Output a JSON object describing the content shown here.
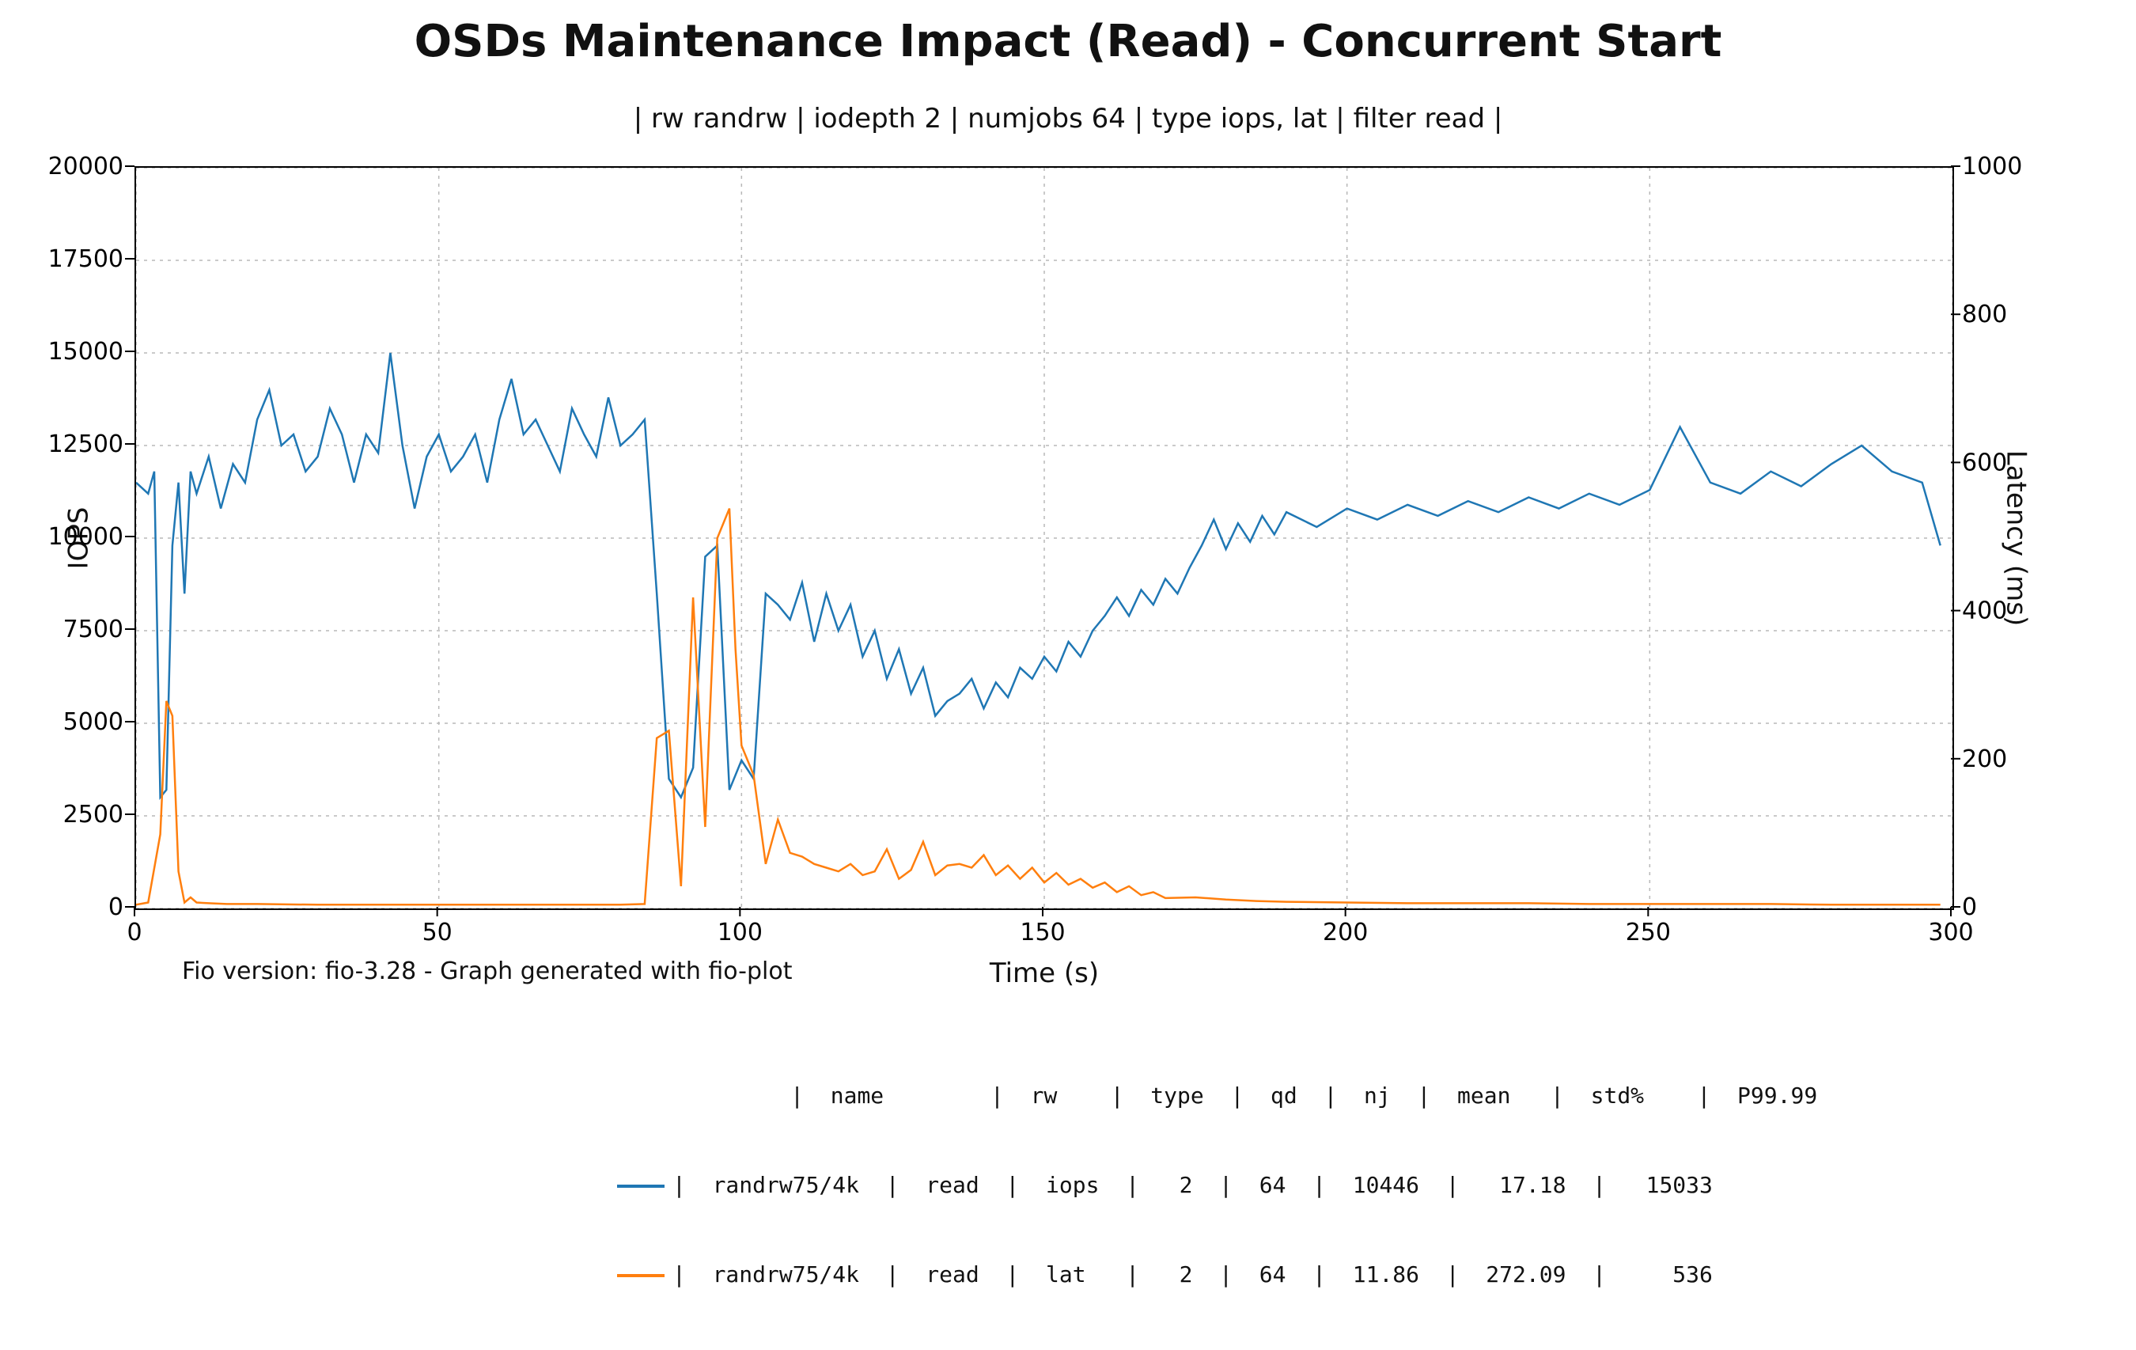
{
  "chart_data": {
    "type": "line",
    "title": "OSDs Maintenance Impact (Read) - Concurrent Start",
    "subtitle": "| rw randrw | iodepth 2 | numjobs 64 | type iops, lat | filter read |",
    "xlabel": "Time (s)",
    "ylabel": "IOPS",
    "y2label": "Latency (ms)",
    "xlim": [
      0,
      300
    ],
    "ylim": [
      0,
      20000
    ],
    "y2lim": [
      0,
      1000
    ],
    "xticks": [
      0,
      50,
      100,
      150,
      200,
      250,
      300
    ],
    "yticks": [
      0,
      2500,
      5000,
      7500,
      10000,
      12500,
      15000,
      17500,
      20000
    ],
    "y2ticks": [
      0,
      200,
      400,
      600,
      800,
      1000
    ],
    "footer_note": "Fio version: fio-3.28 - Graph generated with fio-plot",
    "legend_header": "|  name        |  rw    |  type  |  qd  |  nj  |  mean   |  std%    |  P99.99",
    "series": [
      {
        "name": "iops",
        "axis": "left",
        "color": "#1f77b4",
        "legend_row": "|  randrw75/4k  |  read  |  iops  |   2  |  64  |  10446  |   17.18  |   15033",
        "x": [
          0,
          2,
          3,
          4,
          5,
          6,
          7,
          8,
          9,
          10,
          12,
          14,
          16,
          18,
          20,
          22,
          24,
          26,
          28,
          30,
          32,
          34,
          36,
          38,
          40,
          42,
          44,
          46,
          48,
          50,
          52,
          54,
          56,
          58,
          60,
          62,
          64,
          66,
          68,
          70,
          72,
          74,
          76,
          78,
          80,
          82,
          84,
          86,
          88,
          90,
          92,
          94,
          96,
          98,
          100,
          102,
          104,
          106,
          108,
          110,
          112,
          114,
          116,
          118,
          120,
          122,
          124,
          126,
          128,
          130,
          132,
          134,
          136,
          138,
          140,
          142,
          144,
          146,
          148,
          150,
          152,
          154,
          156,
          158,
          160,
          162,
          164,
          166,
          168,
          170,
          172,
          174,
          176,
          178,
          180,
          182,
          184,
          186,
          188,
          190,
          195,
          200,
          205,
          210,
          215,
          220,
          225,
          230,
          235,
          240,
          245,
          250,
          255,
          260,
          265,
          270,
          275,
          280,
          285,
          290,
          295,
          298
        ],
        "values": [
          11500,
          11200,
          11800,
          3000,
          3200,
          9800,
          11500,
          8500,
          11800,
          11200,
          12200,
          10800,
          12000,
          11500,
          13200,
          14000,
          12500,
          12800,
          11800,
          12200,
          13500,
          12800,
          11500,
          12800,
          12300,
          15000,
          12500,
          10800,
          12200,
          12800,
          11800,
          12200,
          12800,
          11500,
          13200,
          14300,
          12800,
          13200,
          12500,
          11800,
          13500,
          12800,
          12200,
          13800,
          12500,
          12800,
          13200,
          8500,
          3500,
          3000,
          3800,
          9500,
          9800,
          3200,
          4000,
          3500,
          8500,
          8200,
          7800,
          8800,
          7200,
          8500,
          7500,
          8200,
          6800,
          7500,
          6200,
          7000,
          5800,
          6500,
          5200,
          5600,
          5800,
          6200,
          5400,
          6100,
          5700,
          6500,
          6200,
          6800,
          6400,
          7200,
          6800,
          7500,
          7900,
          8400,
          7900,
          8600,
          8200,
          8900,
          8500,
          9200,
          9800,
          10500,
          9700,
          10400,
          9900,
          10600,
          10100,
          10700,
          10300,
          10800,
          10500,
          10900,
          10600,
          11000,
          10700,
          11100,
          10800,
          11200,
          10900,
          11300,
          13000,
          11500,
          11200,
          11800,
          11400,
          12000,
          12500,
          11800,
          11500,
          9800
        ]
      },
      {
        "name": "lat",
        "axis": "right",
        "color": "#ff7f0e",
        "legend_row": "|  randrw75/4k  |  read  |  lat   |   2  |  64  |  11.86  |  272.09  |     536",
        "x": [
          0,
          2,
          4,
          5,
          6,
          7,
          8,
          9,
          10,
          12,
          15,
          20,
          30,
          40,
          50,
          60,
          70,
          80,
          84,
          86,
          88,
          90,
          92,
          94,
          96,
          98,
          99,
          100,
          102,
          104,
          106,
          108,
          110,
          112,
          114,
          116,
          118,
          120,
          122,
          124,
          126,
          128,
          130,
          132,
          134,
          136,
          138,
          140,
          142,
          144,
          146,
          148,
          150,
          152,
          154,
          156,
          158,
          160,
          162,
          164,
          166,
          168,
          170,
          175,
          180,
          185,
          190,
          200,
          210,
          220,
          230,
          240,
          250,
          260,
          270,
          280,
          290,
          298
        ],
        "values": [
          5,
          8,
          100,
          280,
          260,
          50,
          8,
          15,
          8,
          7,
          6,
          6,
          5,
          5,
          5,
          5,
          5,
          5,
          6,
          230,
          240,
          30,
          420,
          110,
          500,
          540,
          350,
          220,
          180,
          60,
          120,
          75,
          70,
          60,
          55,
          50,
          60,
          45,
          50,
          80,
          40,
          52,
          90,
          45,
          58,
          60,
          55,
          72,
          45,
          58,
          40,
          55,
          35,
          48,
          32,
          40,
          28,
          35,
          22,
          30,
          18,
          22,
          14,
          15,
          12,
          10,
          9,
          8,
          7,
          7,
          7,
          6,
          6,
          6,
          6,
          5,
          5,
          5
        ]
      }
    ],
    "legend_stats": [
      {
        "name": "randrw75/4k",
        "rw": "read",
        "type": "iops",
        "qd": 2,
        "nj": 64,
        "mean": 10446,
        "std_pct": 17.18,
        "p9999": 15033
      },
      {
        "name": "randrw75/4k",
        "rw": "read",
        "type": "lat",
        "qd": 2,
        "nj": 64,
        "mean": 11.86,
        "std_pct": 272.09,
        "p9999": 536
      }
    ]
  }
}
